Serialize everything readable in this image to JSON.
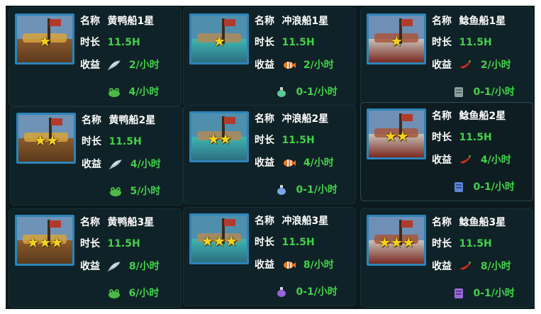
{
  "labels": {
    "name": "名称",
    "duration": "时长",
    "income": "收益"
  },
  "colors": {
    "value_green": "#3fd24a",
    "frame_blue": "#2d84b8",
    "star_gold": "#f4d21c",
    "panel": "#0f2227"
  },
  "ships": [
    {
      "name": "黄鸭船1星",
      "duration": "11.5H",
      "income": "2/小时",
      "income_icon": "feather-icon",
      "bonus": "4/小时",
      "bonus_icon": "green-frog-icon",
      "stars": "★",
      "theme": "duck"
    },
    {
      "name": "冲浪船1星",
      "duration": "11.5H",
      "income": "2/小时",
      "income_icon": "clownfish-icon",
      "bonus": "0-1/小时",
      "bonus_icon": "green-potion-icon",
      "stars": "★",
      "theme": "surf"
    },
    {
      "name": "鲶鱼船1星",
      "duration": "11.5H",
      "income": "2/小时",
      "income_icon": "red-chili-icon",
      "bonus": "0-1/小时",
      "bonus_icon": "grey-scroll-icon",
      "stars": "★",
      "theme": "catfish"
    },
    {
      "name": "黄鸭船2星",
      "duration": "11.5H",
      "income": "4/小时",
      "income_icon": "feather-icon",
      "bonus": "5/小时",
      "bonus_icon": "green-frog-icon",
      "stars": "★★",
      "theme": "duck"
    },
    {
      "name": "冲浪船2星",
      "duration": "11.5H",
      "income": "4/小时",
      "income_icon": "clownfish-icon",
      "bonus": "0-1/小时",
      "bonus_icon": "blue-potion-icon",
      "stars": "★★",
      "theme": "surf"
    },
    {
      "name": "鲶鱼船2星",
      "duration": "11.5H",
      "income": "4/小时",
      "income_icon": "red-chili-icon",
      "bonus": "0-1/小时",
      "bonus_icon": "blue-scroll-icon",
      "stars": "★★",
      "theme": "catfish"
    },
    {
      "name": "黄鸭船3星",
      "duration": "11.5H",
      "income": "8/小时",
      "income_icon": "feather-icon",
      "bonus": "6/小时",
      "bonus_icon": "green-frog-icon",
      "stars": "★★★",
      "theme": "duck"
    },
    {
      "name": "冲浪船3星",
      "duration": "11.5H",
      "income": "8/小时",
      "income_icon": "clownfish-icon",
      "bonus": "0-1/小时",
      "bonus_icon": "purple-potion-icon",
      "stars": "★★★",
      "theme": "surf"
    },
    {
      "name": "鲶鱼船3星",
      "duration": "11.5H",
      "income": "8/小时",
      "income_icon": "red-chili-icon",
      "bonus": "0-1/小时",
      "bonus_icon": "purple-scroll-icon",
      "stars": "★★★",
      "theme": "catfish"
    }
  ]
}
